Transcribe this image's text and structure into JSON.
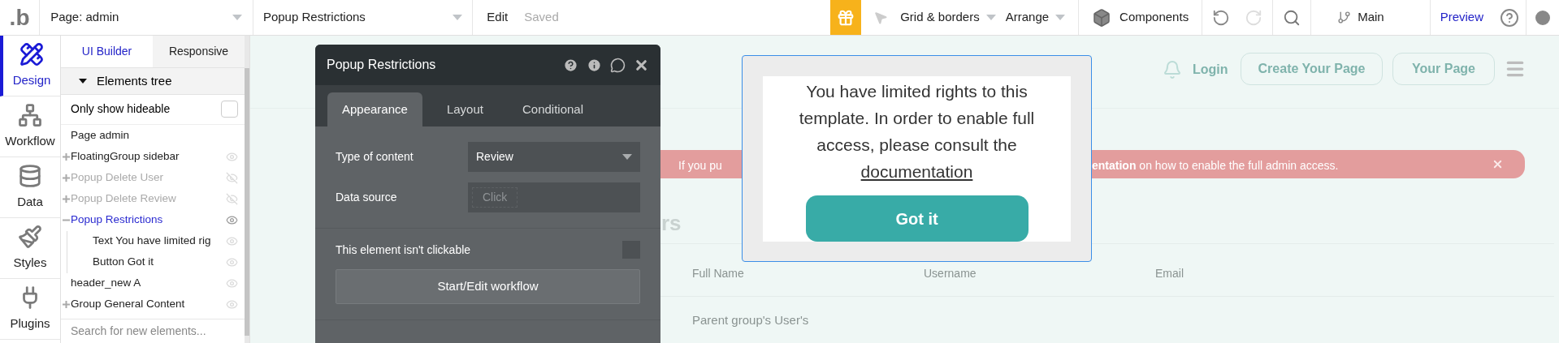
{
  "toolbar": {
    "logo": ".b",
    "page_selector": "Page: admin",
    "element_selector": "Popup Restrictions",
    "edit": "Edit",
    "status": "Saved",
    "grid": "Grid & borders",
    "arrange": "Arrange",
    "components": "Components",
    "undo": {
      "disabled": false
    },
    "redo": {
      "disabled": true
    },
    "branch": "Main",
    "preview": "Preview"
  },
  "sidebar": {
    "items": [
      {
        "label": "Design",
        "kind": "design",
        "selected": true
      },
      {
        "label": "Workflow",
        "kind": "workflow",
        "selected": false
      },
      {
        "label": "Data",
        "kind": "data",
        "selected": false
      },
      {
        "label": "Styles",
        "kind": "styles",
        "selected": false
      },
      {
        "label": "Plugins",
        "kind": "plugins",
        "selected": false
      }
    ]
  },
  "panel": {
    "tabs": [
      {
        "label": "UI Builder",
        "selected": true
      },
      {
        "label": "Responsive",
        "selected": false
      }
    ],
    "section": {
      "title": "Elements tree",
      "expanded": true
    },
    "filter": {
      "label": "Only show hideable",
      "checked": false
    },
    "tree": [
      {
        "label": "Page admin",
        "kind": "page",
        "hidden": false,
        "selected": false
      },
      {
        "label": "FloatingGroup sidebar",
        "kind": "group",
        "expanded": false,
        "hidden": false,
        "selected": false
      },
      {
        "label": "Popup Delete User",
        "kind": "group",
        "expanded": false,
        "hidden": true,
        "selected": false
      },
      {
        "label": "Popup Delete Review",
        "kind": "group",
        "expanded": false,
        "hidden": true,
        "selected": false
      },
      {
        "label": "Popup Restrictions",
        "kind": "group",
        "expanded": true,
        "hidden": false,
        "selected": true,
        "children": [
          {
            "label": "Text You have limited rig",
            "kind": "element",
            "hidden": false,
            "selected": false
          },
          {
            "label": "Button Got it",
            "kind": "element",
            "hidden": false,
            "selected": false
          }
        ]
      },
      {
        "label": "header_new A",
        "kind": "element",
        "hidden": false,
        "selected": false
      },
      {
        "label": "Group General Content",
        "kind": "group",
        "expanded": false,
        "hidden": false,
        "selected": false
      }
    ],
    "search": {
      "placeholder": "Search for new elements..."
    }
  },
  "property_editor": {
    "title": "Popup Restrictions",
    "tabs": [
      {
        "label": "Appearance",
        "selected": true
      },
      {
        "label": "Layout",
        "selected": false
      },
      {
        "label": "Conditional",
        "selected": false
      }
    ],
    "type_of_content": {
      "label": "Type of content",
      "value": "Review"
    },
    "data_source": {
      "label": "Data source",
      "placeholder": "Click"
    },
    "not_clickable": {
      "label": "This element isn't clickable",
      "checked": false
    },
    "workflow_button": "Start/Edit workflow"
  },
  "canvas": {
    "header": {
      "login": "Login",
      "buttons": [
        "Create Your Page",
        "Your Page"
      ]
    },
    "banner": {
      "left": "If you pu",
      "right": "**entation** on how to enable the full admin access."
    },
    "heading": "rs",
    "columns": [
      "Full Name",
      "Username",
      "Email"
    ],
    "row": "Parent group's User's",
    "popup": {
      "text": "You have limited rights to this template. In order to enable full access, please consult the",
      "link": "documentation",
      "button": "Got it"
    }
  }
}
